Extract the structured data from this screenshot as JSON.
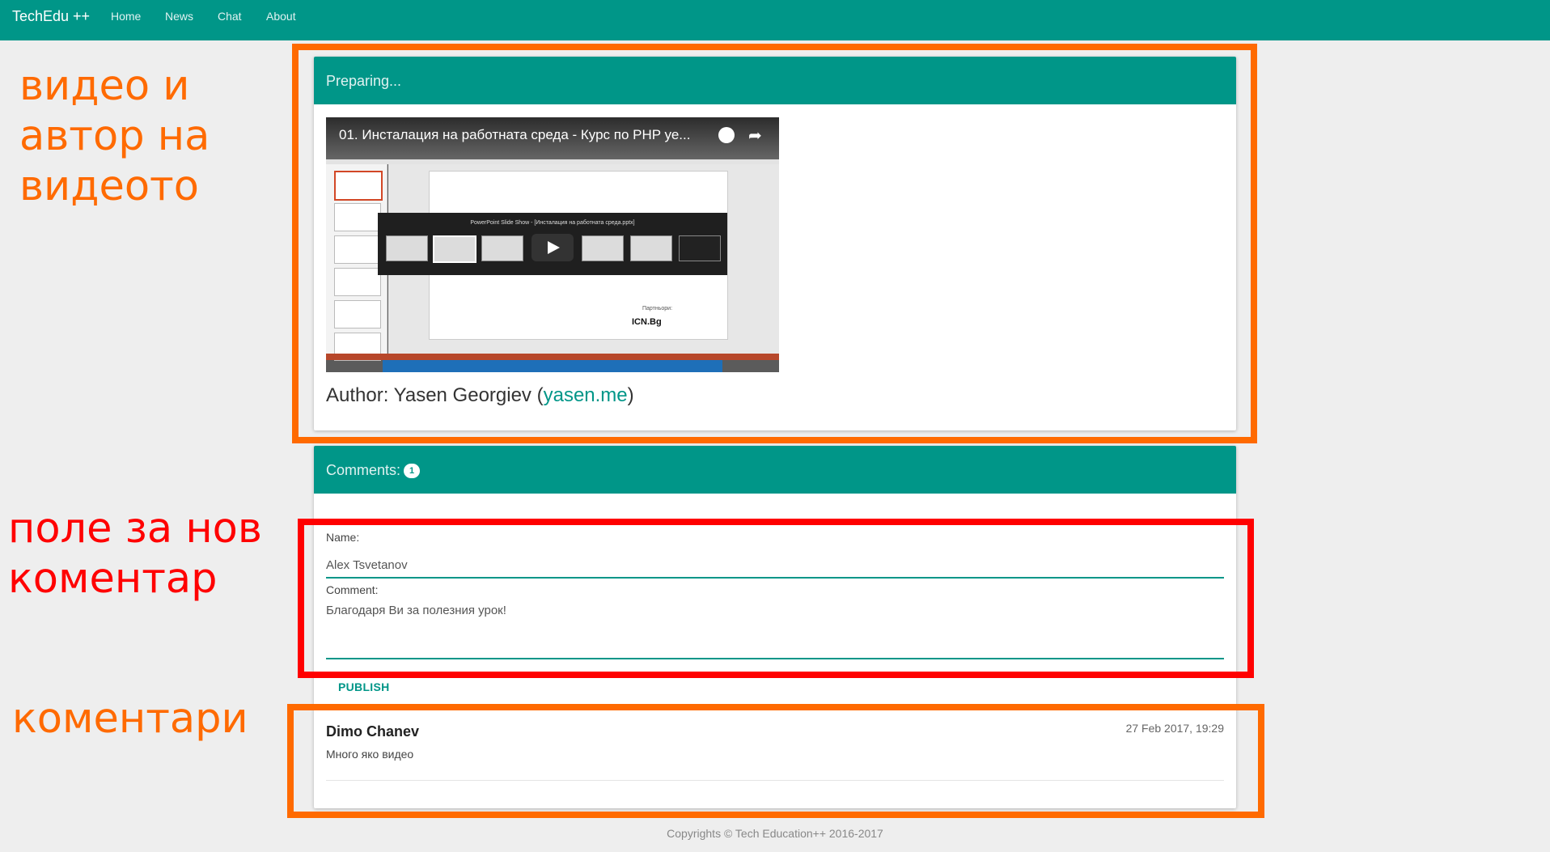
{
  "navbar": {
    "brand": "TechEdu ++",
    "links": [
      "Home",
      "News",
      "Chat",
      "About"
    ]
  },
  "video_card": {
    "header": "Preparing...",
    "video": {
      "title": "01. Инсталация на работната среда - Курс по PHP уе...",
      "slideshow_title": "PowerPoint Slide Show - [Инсталация на работната среда.pptx]",
      "partners_label": "Партньори:",
      "partner_logo": "ICN.Bg"
    },
    "author_prefix": "Author: Yasen Georgiev (",
    "author_link": "yasen.me",
    "author_suffix": ")"
  },
  "comments_card": {
    "header_label": "Comments:",
    "count": "1",
    "form": {
      "name_label": "Name:",
      "name_value": "Alex Tsvetanov",
      "comment_label": "Comment:",
      "comment_value": "Благодаря Ви за полезния урок!",
      "publish_label": "PUBLISH"
    },
    "comments": [
      {
        "author": "Dimo Chanev",
        "date": "27 Feb 2017, 19:29",
        "text": "Много яко видео"
      }
    ]
  },
  "footer": {
    "text": "Copyrights © Tech Education++ 2016-2017"
  },
  "annotations": {
    "video_note": [
      "видео и",
      "автор на",
      "видеото"
    ],
    "form_note": [
      "поле за нов",
      "коментар"
    ],
    "comments_note": [
      "коментари"
    ]
  },
  "colors": {
    "primary": "#009688",
    "annotation_orange": "#ff6a00",
    "annotation_red": "#ff0000"
  }
}
